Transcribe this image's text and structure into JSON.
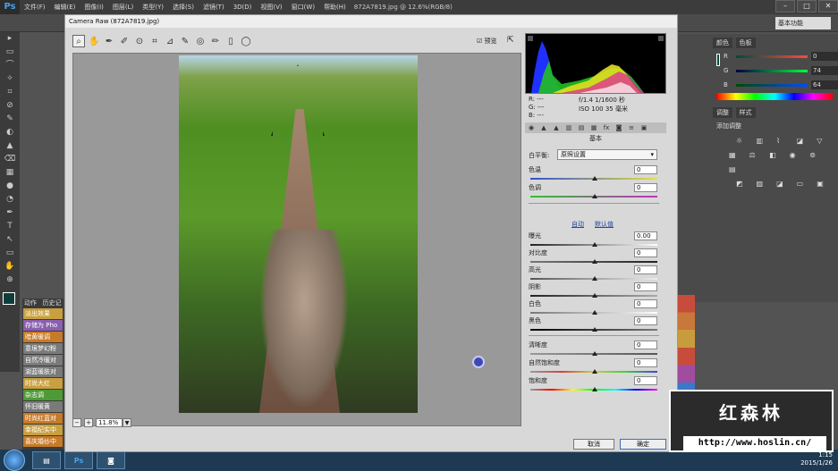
{
  "ps": {
    "logo": "Ps",
    "menu": [
      "文件(F)",
      "编辑(E)",
      "图像(I)",
      "图层(L)",
      "类型(Y)",
      "选择(S)",
      "滤镜(T)",
      "3D(D)",
      "视图(V)",
      "窗口(W)",
      "帮助(H)"
    ],
    "doc_tab": "872A7819.jpg @ 12.6%(RGB/8)",
    "workspace": "基本功能",
    "win_min": "–",
    "win_max": "□",
    "win_close": "✕"
  },
  "tools": [
    "▸",
    "▭",
    "⌒",
    "✧",
    "⌗",
    "⊘",
    "✎",
    "◐",
    "▲",
    "⌫",
    "▦",
    "●",
    "◔",
    "✒",
    "T",
    "↖",
    "▭",
    "✋",
    "⊕"
  ],
  "actions_panel": {
    "tabs": [
      "动作",
      "历史记"
    ],
    "rows": [
      {
        "label": "淡出效果",
        "color": "#c8a040"
      },
      {
        "label": "存储为 Pho",
        "color": "#8b5fb0"
      },
      {
        "label": "暗黄暖调",
        "color": "#c77a28"
      },
      {
        "label": "意境梦幻粉",
        "color": "#7a7a7a"
      },
      {
        "label": "自然冷暖对",
        "color": "#7a7a7a"
      },
      {
        "label": "湖蓝暖肤对",
        "color": "#7a7a7a"
      },
      {
        "label": "时尚大红",
        "color": "#c8a040"
      },
      {
        "label": "杂志调",
        "color": "#4f9a38"
      },
      {
        "label": "怀旧暖黄",
        "color": "#7a7a7a"
      },
      {
        "label": "时尚红蓝对",
        "color": "#c77a28"
      },
      {
        "label": "幸福纪实中",
        "color": "#c8a040"
      },
      {
        "label": "喜庆婚纱中",
        "color": "#c77a28"
      }
    ]
  },
  "color_panel": {
    "tabs": [
      "颜色",
      "色板"
    ],
    "rows": [
      {
        "label": "R",
        "value": "0"
      },
      {
        "label": "G",
        "value": "74"
      },
      {
        "label": "B",
        "value": "64"
      }
    ]
  },
  "adjust_panel": {
    "tabs": [
      "调整",
      "样式"
    ],
    "title": "添加调整"
  },
  "camera_raw": {
    "title": "Camera Raw (872A7819.jpg)",
    "preview_label": "预览",
    "zoom": "11.8%",
    "readout": {
      "r": "R:  ---",
      "g": "G:  ---",
      "b": "B:  ---",
      "aperture": "f/1.4   1/1600 秒",
      "iso": "ISO 100   35 毫米"
    },
    "panel_title": "基本",
    "white_balance_label": "白平衡:",
    "white_balance_value": "原照设置",
    "rows": [
      {
        "label": "色温",
        "value": "0"
      },
      {
        "label": "色调",
        "value": "0"
      },
      {
        "label": "曝光",
        "value": "0.00"
      },
      {
        "label": "对比度",
        "value": "0"
      },
      {
        "label": "高光",
        "value": "0"
      },
      {
        "label": "阴影",
        "value": "0"
      },
      {
        "label": "白色",
        "value": "0"
      },
      {
        "label": "黑色",
        "value": "0"
      },
      {
        "label": "清晰度",
        "value": "0"
      },
      {
        "label": "自然饱和度",
        "value": "0"
      },
      {
        "label": "饱和度",
        "value": "0"
      }
    ],
    "auto": "自动",
    "default": "默认值",
    "cancel": "取消",
    "ok": "确定"
  },
  "watermark": {
    "title": "红森林",
    "url": "http://www.hoslin.cn/"
  },
  "taskbar": {
    "time": "1:15",
    "date": "2015/1/26"
  }
}
